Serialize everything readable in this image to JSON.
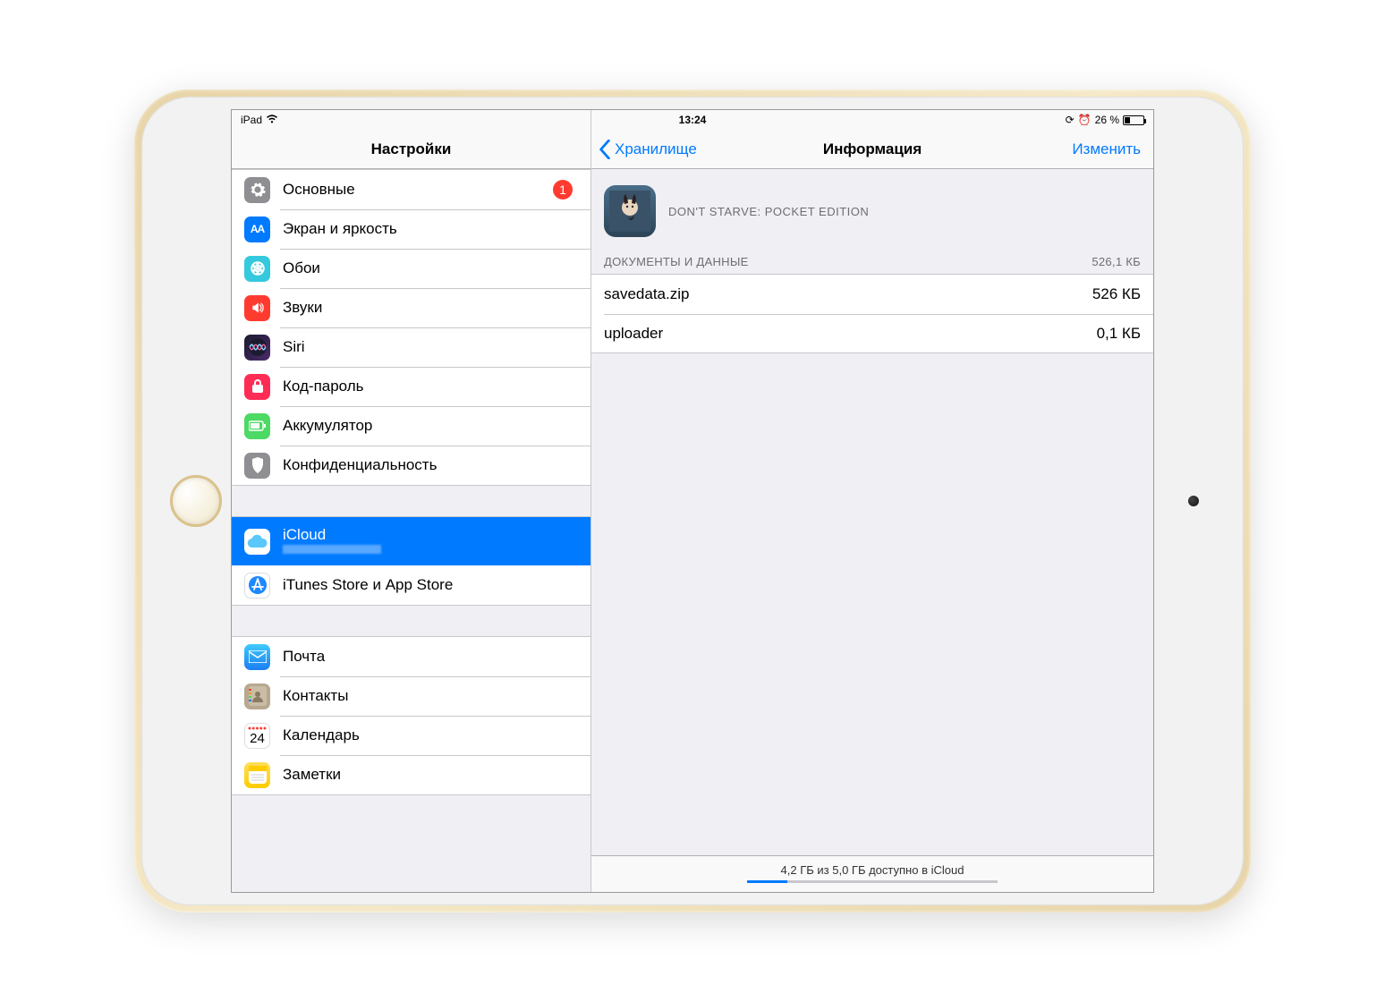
{
  "status": {
    "carrier": "iPad",
    "time": "13:24",
    "battery_pct": "26 %"
  },
  "sidebar": {
    "title": "Настройки",
    "groups": [
      {
        "items": [
          {
            "key": "general",
            "label": "Основные",
            "icon": "gear",
            "badge": "1"
          },
          {
            "key": "display",
            "label": "Экран и яркость",
            "icon": "display"
          },
          {
            "key": "wallpaper",
            "label": "Обои",
            "icon": "wallpaper"
          },
          {
            "key": "sounds",
            "label": "Звуки",
            "icon": "sounds"
          },
          {
            "key": "siri",
            "label": "Siri",
            "icon": "siri"
          },
          {
            "key": "passcode",
            "label": "Код-пароль",
            "icon": "passcode"
          },
          {
            "key": "battery",
            "label": "Аккумулятор",
            "icon": "battery"
          },
          {
            "key": "privacy",
            "label": "Конфиденциальность",
            "icon": "privacy"
          }
        ]
      },
      {
        "items": [
          {
            "key": "icloud",
            "label": "iCloud",
            "sublabel": "",
            "icon": "icloud",
            "selected": true
          },
          {
            "key": "itunes",
            "label": "iTunes Store и App Store",
            "icon": "appstore"
          }
        ]
      },
      {
        "items": [
          {
            "key": "mail",
            "label": "Почта",
            "icon": "mail"
          },
          {
            "key": "contacts",
            "label": "Контакты",
            "icon": "contacts"
          },
          {
            "key": "calendar",
            "label": "Календарь",
            "icon": "calendar"
          },
          {
            "key": "notes",
            "label": "Заметки",
            "icon": "notes"
          }
        ]
      }
    ]
  },
  "detail": {
    "back_label": "Хранилище",
    "title": "Информация",
    "edit_label": "Изменить",
    "app_name": "DON'T STARVE: POCKET EDITION",
    "docs_header": "ДОКУМЕНТЫ И ДАННЫЕ",
    "docs_total": "526,1 КБ",
    "files": [
      {
        "name": "savedata.zip",
        "size": "526 КБ"
      },
      {
        "name": "uploader",
        "size": "0,1 КБ"
      }
    ],
    "footer": "4,2 ГБ из 5,0 ГБ доступно в iCloud",
    "storage_used_pct": 16
  }
}
